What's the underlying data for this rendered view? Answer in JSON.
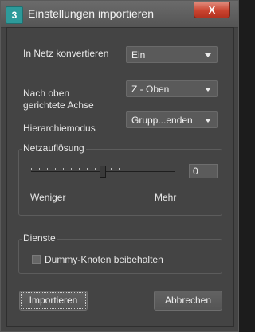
{
  "window": {
    "title": "Einstellungen importieren",
    "close_glyph": "X",
    "app_icon_text": "3",
    "app_icon": "3ds-max-icon"
  },
  "fields": {
    "convert_label": "In Netz konvertieren",
    "convert_value": "Ein",
    "up_axis_label_line1": "Nach oben",
    "up_axis_label_line2": "gerichtete Achse",
    "up_axis_value": "Z - Oben",
    "hierarchy_label": "Hierarchiemodus",
    "hierarchy_value": "Grupp...enden"
  },
  "mesh_resolution": {
    "group_title": "Netzauflösung",
    "value": "0",
    "slider_position": 0.5,
    "less_label": "Weniger",
    "more_label": "Mehr"
  },
  "services": {
    "group_title": "Dienste",
    "dummy_nodes_label": "Dummy-Knoten beibehalten",
    "dummy_nodes_checked": false
  },
  "buttons": {
    "import_label": "Importieren",
    "cancel_label": "Abbrechen"
  }
}
